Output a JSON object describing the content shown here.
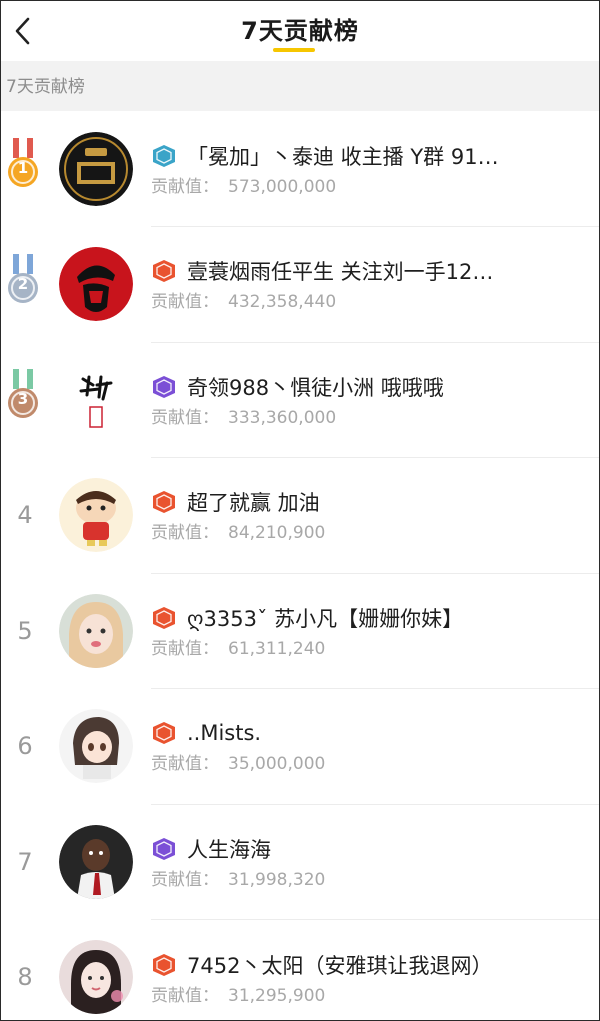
{
  "header": {
    "title": "7天贡献榜",
    "back_icon": "chevron-left-icon",
    "accent_color": "#f6c600"
  },
  "section": {
    "label": "7天贡献榜"
  },
  "score_label": "贡献值：",
  "colors": {
    "gold": "#f5a623",
    "silver": "#a6b4c6",
    "bronze": "#c08a6b",
    "ribbon": "#7bc9c4",
    "badge_red": "#e9532f",
    "badge_purple": "#7b4fd6",
    "badge_teal": "#3aa4c8"
  },
  "rankings": [
    {
      "rank": "1",
      "medal": "gold",
      "badge": "子",
      "badge_color": "teal",
      "name": "「冕加」丶泰迪 收主播 Y群 91…",
      "score": "573,000,000",
      "avatar": "logo-avatar"
    },
    {
      "rank": "2",
      "medal": "silver",
      "badge": "王",
      "badge_color": "red",
      "name": "壹蓑烟雨任平生 关注刘一手12…",
      "score": "432,358,440",
      "avatar": "portrait-avatar"
    },
    {
      "rank": "3",
      "medal": "bronze",
      "badge": "公",
      "badge_color": "purple",
      "name": "奇领988丶惧徒小洲 哦哦哦",
      "score": "333,360,000",
      "avatar": "calligraphy-avatar"
    },
    {
      "rank": "4",
      "medal": "",
      "badge": "王",
      "badge_color": "red",
      "name": "超了就赢 加油",
      "score": "84,210,900",
      "avatar": "cartoon-avatar"
    },
    {
      "rank": "5",
      "medal": "",
      "badge": "王",
      "badge_color": "red",
      "name": "ღ3353ˇ 苏小凡【姗姗你妹】",
      "score": "61,311,240",
      "avatar": "girl-avatar"
    },
    {
      "rank": "6",
      "medal": "",
      "badge": "王",
      "badge_color": "red",
      "name": "..Mists.",
      "score": "35,000,000",
      "avatar": "anime-avatar"
    },
    {
      "rank": "7",
      "medal": "",
      "badge": "公",
      "badge_color": "purple",
      "name": "人生海海",
      "score": "31,998,320",
      "avatar": "child-avatar"
    },
    {
      "rank": "8",
      "medal": "",
      "badge": "王",
      "badge_color": "red",
      "name": "7452丶太阳（安雅琪让我退网）",
      "score": "31,295,900",
      "avatar": "woman-avatar"
    }
  ]
}
